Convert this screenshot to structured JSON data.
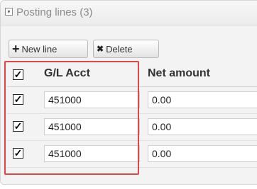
{
  "panel": {
    "title": "Posting lines (3)",
    "collapse_icon": "collapse-toggle-icon"
  },
  "toolbar": {
    "new_line_label": "New line",
    "new_line_icon": "+",
    "delete_label": "Delete",
    "delete_icon": "✖"
  },
  "table": {
    "columns": [
      "G/L Acct",
      "Net amount"
    ],
    "header_checked": true,
    "rows": [
      {
        "checked": true,
        "gl_acct": "451000",
        "net_amount": "0.00"
      },
      {
        "checked": true,
        "gl_acct": "451000",
        "net_amount": "0.00"
      },
      {
        "checked": true,
        "gl_acct": "451000",
        "net_amount": "0.00"
      }
    ]
  },
  "colors": {
    "highlight": "#e2464b",
    "panel_bg": "#f3f3f3"
  }
}
